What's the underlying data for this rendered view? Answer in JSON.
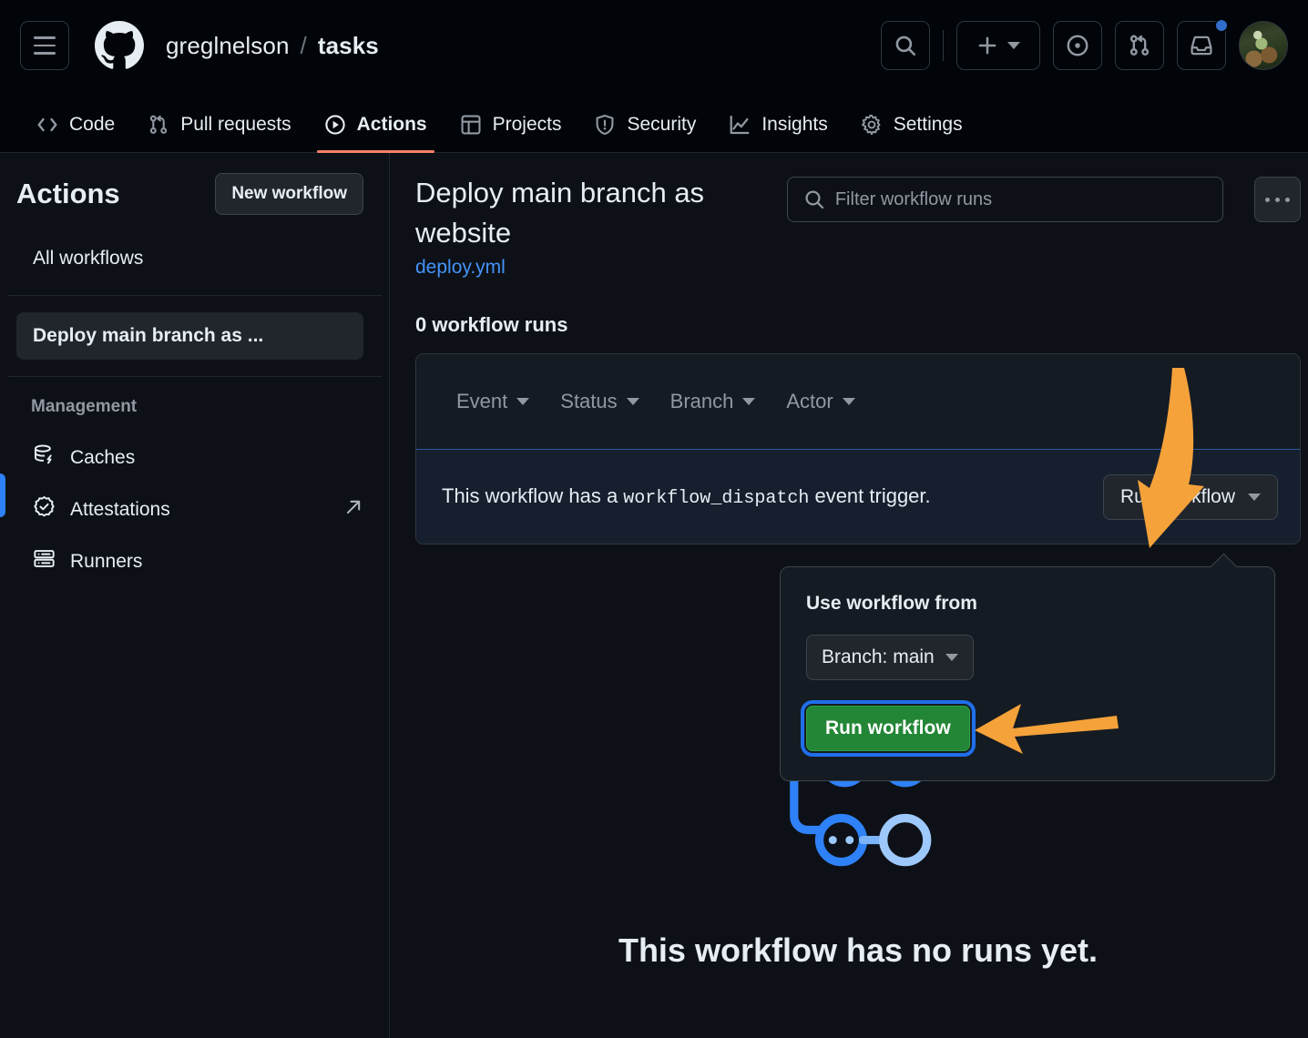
{
  "header": {
    "menu_label": "Open menu",
    "logo_label": "GitHub",
    "owner": "greglnelson",
    "separator": "/",
    "repo": "tasks",
    "actions": [
      {
        "name": "search-button",
        "icon": "search-icon"
      },
      {
        "name": "create-new-button",
        "icon": "plus-icon"
      },
      {
        "name": "issues-button",
        "icon": "issue-opened-icon"
      },
      {
        "name": "pull-requests-button",
        "icon": "git-pull-request-icon"
      },
      {
        "name": "notifications-button",
        "icon": "inbox-icon",
        "badge": true
      }
    ],
    "avatar_label": "User avatar"
  },
  "repo_nav": {
    "items": [
      {
        "label": "Code",
        "icon": "code-icon",
        "active": false
      },
      {
        "label": "Pull requests",
        "icon": "git-pull-request-icon",
        "active": false
      },
      {
        "label": "Actions",
        "icon": "play-icon",
        "active": true
      },
      {
        "label": "Projects",
        "icon": "table-icon",
        "active": false
      },
      {
        "label": "Security",
        "icon": "shield-icon",
        "active": false
      },
      {
        "label": "Insights",
        "icon": "graph-icon",
        "active": false
      },
      {
        "label": "Settings",
        "icon": "gear-icon",
        "active": false
      }
    ],
    "active_underline_color": "#f78166"
  },
  "sidebar": {
    "title": "Actions",
    "new_workflow_label": "New workflow",
    "all_workflows_label": "All workflows",
    "selected_workflow": "Deploy main branch as ...",
    "selected_indicator_color": "#2f81f7",
    "management_title": "Management",
    "management_items": [
      {
        "label": "Caches",
        "icon": "cache-icon",
        "external": false
      },
      {
        "label": "Attestations",
        "icon": "verified-icon",
        "external": true
      },
      {
        "label": "Runners",
        "icon": "server-icon",
        "external": false
      }
    ]
  },
  "main": {
    "workflow_title": "Deploy main branch as website",
    "workflow_file": "deploy.yml",
    "filter_placeholder": "Filter workflow runs",
    "filter_value": "",
    "kebab_label": "More options",
    "runs_count_label": "0 workflow runs",
    "filters": [
      {
        "label": "Event"
      },
      {
        "label": "Status"
      },
      {
        "label": "Branch"
      },
      {
        "label": "Actor"
      }
    ],
    "notice": {
      "prefix": "This workflow has a ",
      "code": "workflow_dispatch",
      "suffix": " event trigger.",
      "run_button_label": "Run workflow",
      "accent_color": "#2f5a9e"
    },
    "dropdown_panel": {
      "heading": "Use workflow from",
      "branch_label": "Branch: main",
      "run_button_label": "Run workflow",
      "run_button_color": "#238636",
      "focus_ring_color": "#1f6feb"
    },
    "empty_state": {
      "title": "This workflow has no runs yet.",
      "illustration": "workflow-graph-illustration",
      "illustration_color": "#2f81f7"
    }
  },
  "annotations": {
    "arrow_color": "#f5a23a",
    "arrows": [
      {
        "name": "arrow-to-run-workflow-dropdown",
        "direction": "down"
      },
      {
        "name": "arrow-to-green-run-workflow",
        "direction": "left"
      }
    ]
  }
}
